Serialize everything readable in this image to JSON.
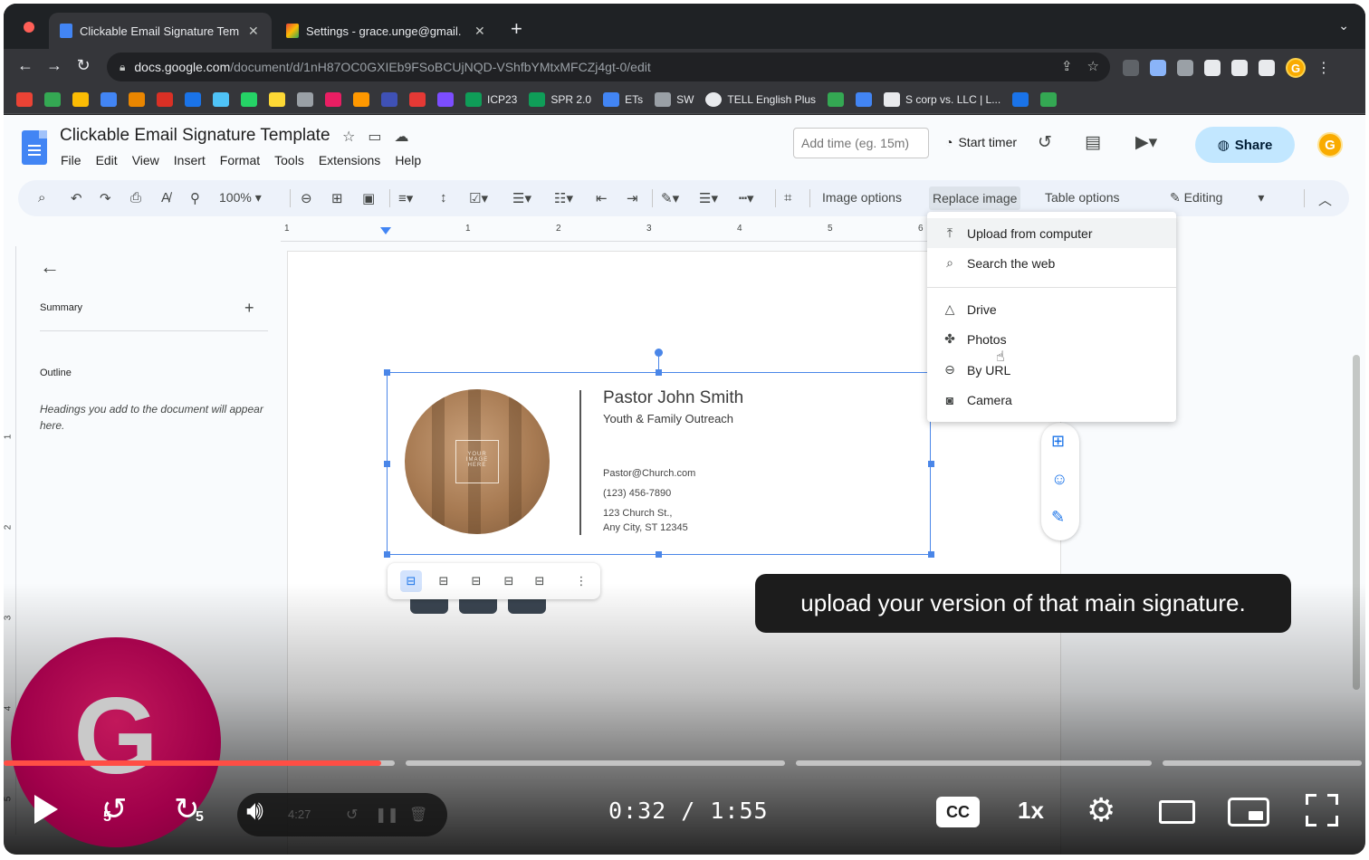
{
  "browser": {
    "tabs": [
      {
        "title": "Clickable Email Signature Tem",
        "active": true,
        "icon": "docs-icon"
      },
      {
        "title": "Settings - grace.unge@gmail.",
        "active": false,
        "icon": "gmail-icon"
      }
    ],
    "url_host": "docs.google.com",
    "url_path": "/document/d/1nH87OC0GXIEb9FSoBCUjNQD-VShfbYMtxMFCZj4gt-0/edit",
    "profile_initial": "G",
    "bookmarks": [
      {
        "label": "ICP23"
      },
      {
        "label": "SPR 2.0"
      },
      {
        "label": "ETs"
      },
      {
        "label": "SW"
      },
      {
        "label": "TELL English Plus"
      },
      {
        "label": "S corp vs. LLC | L..."
      }
    ]
  },
  "doc": {
    "title": "Clickable Email Signature Template",
    "menu": [
      "File",
      "Edit",
      "View",
      "Insert",
      "Format",
      "Tools",
      "Extensions",
      "Help"
    ],
    "add_time_placeholder": "Add time (eg. 15m)",
    "start_timer": "Start timer",
    "share": "Share",
    "user_initial": "G",
    "toolbar": {
      "zoom": "100%",
      "image_options": "Image options",
      "replace_image": "Replace image",
      "table_options": "Table options",
      "editing": "Editing"
    },
    "ruler_h": [
      "1",
      "1",
      "2",
      "3",
      "4",
      "5",
      "6"
    ],
    "ruler_v": [
      "1",
      "2",
      "3",
      "4",
      "5"
    ],
    "outline": {
      "summary": "Summary",
      "outline": "Outline",
      "hint": "Headings you add to the document will appear here."
    },
    "signature": {
      "name": "Pastor John Smith",
      "role": "Youth & Family Outreach",
      "email": "Pastor@Church.com",
      "phone": "(123) 456-7890",
      "address1": "123 Church St.,",
      "address2": "Any City, ST 12345",
      "photo_text": "YOUR IMAGE HERE"
    },
    "replace_menu": {
      "items_top": [
        {
          "label": "Upload from computer",
          "icon": "upload-icon"
        },
        {
          "label": "Search the web",
          "icon": "search-icon"
        }
      ],
      "items_bottom": [
        {
          "label": "Drive",
          "icon": "drive-icon"
        },
        {
          "label": "Photos",
          "icon": "photos-icon"
        },
        {
          "label": "By URL",
          "icon": "link-icon"
        },
        {
          "label": "Camera",
          "icon": "camera-icon"
        }
      ]
    }
  },
  "video": {
    "caption": "upload your version of that main signature.",
    "facecam_letter": "G",
    "current_time": "0:32",
    "duration": "1:55",
    "progress": 0.278,
    "skip_back": "5",
    "skip_forward": "5",
    "recorder_time": "4:27",
    "cc": "CC",
    "speed": "1x",
    "colors": {
      "progress": "#ff4e45",
      "share": "#c2e7ff",
      "selection": "#4a86e8"
    }
  }
}
